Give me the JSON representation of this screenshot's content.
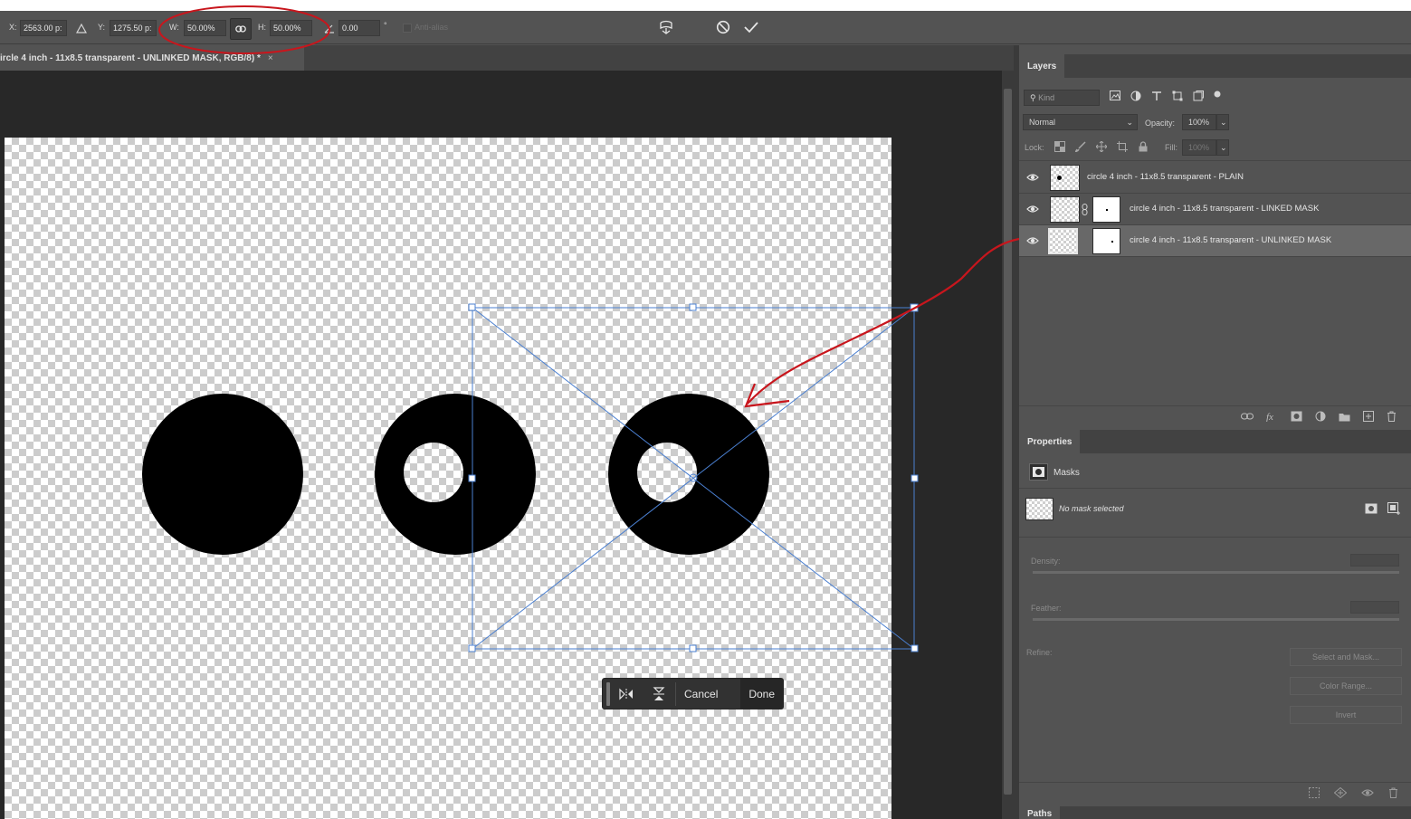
{
  "options_bar": {
    "x_label": "X:",
    "x_value": "2563.00 p:",
    "y_label": "Y:",
    "y_value": "1275.50 p:",
    "w_label": "W:",
    "w_value": "50.00%",
    "h_label": "H:",
    "h_value": "50.00%",
    "angle_value": "0.00",
    "degree_symbol": "°",
    "antialias_label": "Anti-alias"
  },
  "document_tab": {
    "title": "ircle 4 inch - 11x8.5 transparent - UNLINKED MASK, RGB/8) *",
    "close": "×"
  },
  "task_bar": {
    "cancel_label": "Cancel",
    "done_label": "Done"
  },
  "layers_panel": {
    "title": "Layers",
    "kind_placeholder": "Kind",
    "blend_mode": "Normal",
    "opacity_label": "Opacity:",
    "opacity_value": "100%",
    "lock_label": "Lock:",
    "fill_label": "Fill:",
    "fill_value": "100%",
    "layers": [
      {
        "name": "circle 4 inch - 11x8.5 transparent - PLAIN",
        "selected": false
      },
      {
        "name": "circle 4 inch - 11x8.5 transparent - LINKED MASK",
        "selected": false
      },
      {
        "name": "circle 4 inch - 11x8.5 transparent - UNLINKED MASK",
        "selected": true
      }
    ]
  },
  "properties_panel": {
    "title": "Properties",
    "section": "Masks",
    "no_mask_text": "No mask selected",
    "density_label": "Density:",
    "feather_label": "Feather:",
    "refine_label": "Refine:",
    "select_and_mask": "Select and Mask...",
    "color_range": "Color Range...",
    "invert": "Invert"
  },
  "paths_panel": {
    "title": "Paths"
  },
  "colors": {
    "annotation_red": "#c8161d",
    "transform_blue": "#4a7fd0"
  }
}
